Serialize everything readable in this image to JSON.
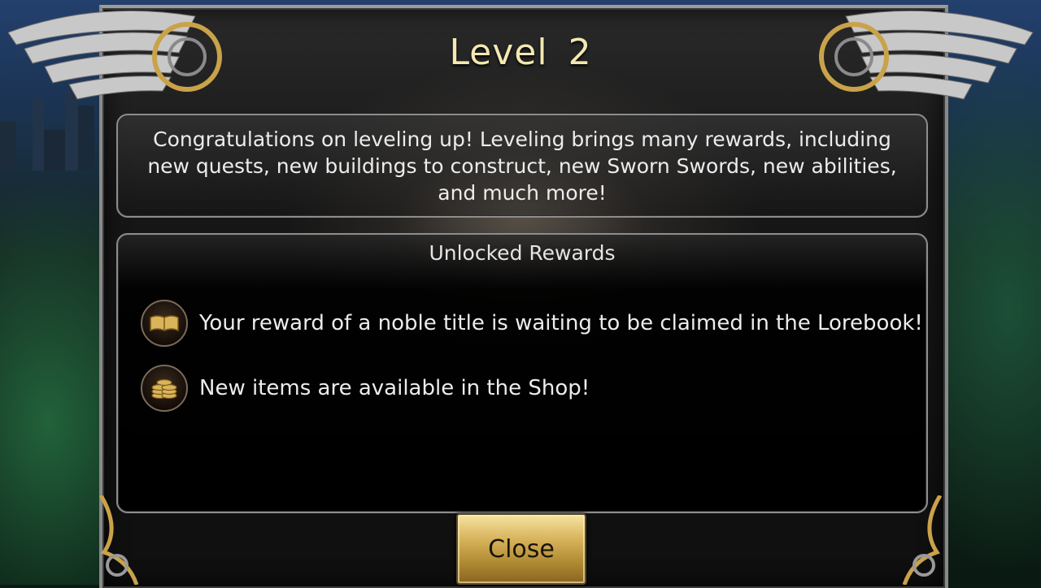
{
  "dialog": {
    "title": "Level  2",
    "intro": "Congratulations on leveling up! Leveling brings many rewards, including new quests, new buildings to construct, new Sworn Swords, new abilities, and much more!",
    "rewards_heading": "Unlocked Rewards",
    "rewards": [
      {
        "icon": "book-icon",
        "text": "Your reward of a noble title is waiting to be claimed in the Lorebook!"
      },
      {
        "icon": "coins-icon",
        "text": "New items are available in the Shop!"
      }
    ],
    "close_label": "Close"
  },
  "colors": {
    "title": "#f3e8b0",
    "button_gold": "#d8b45c",
    "panel_border": "#8d8d8d"
  }
}
